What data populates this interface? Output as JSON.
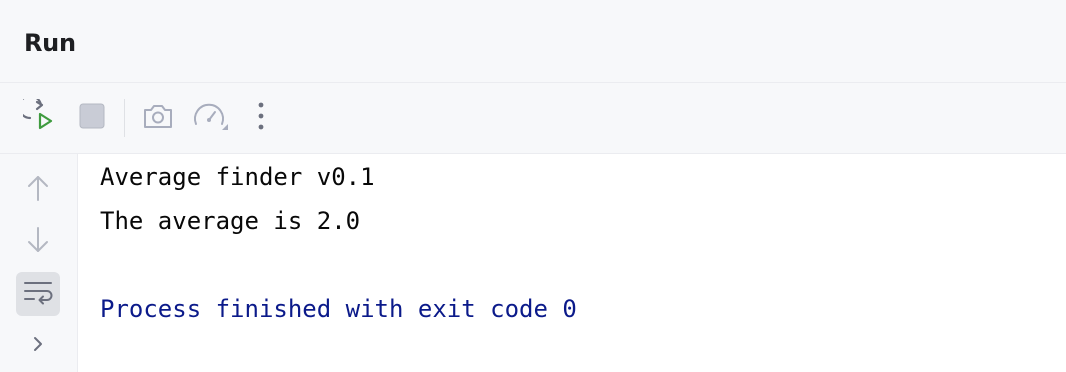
{
  "window": {
    "title": "Run"
  },
  "toolbar": {
    "buttons": [
      {
        "name": "rerun",
        "icon": "rerun-icon",
        "enabled": true
      },
      {
        "name": "stop",
        "icon": "stop-icon",
        "enabled": false
      },
      {
        "name": "screenshot",
        "icon": "camera-icon",
        "enabled": false
      },
      {
        "name": "profiler",
        "icon": "gauge-icon",
        "enabled": false
      },
      {
        "name": "more",
        "icon": "more-vertical-icon",
        "enabled": true
      }
    ]
  },
  "gutter": {
    "buttons": [
      {
        "name": "previous-occurrence",
        "icon": "arrow-up-icon"
      },
      {
        "name": "next-occurrence",
        "icon": "arrow-down-icon"
      },
      {
        "name": "soft-wrap",
        "icon": "soft-wrap-icon",
        "active": true
      },
      {
        "name": "expand",
        "icon": "chevron-right-icon"
      }
    ]
  },
  "console": {
    "lines": [
      {
        "text": "Average finder v0.1",
        "kind": "stdout"
      },
      {
        "text": "The average is 2.0",
        "kind": "stdout"
      },
      {
        "text": "",
        "kind": "stdout"
      },
      {
        "text": "Process finished with exit code 0",
        "kind": "system"
      }
    ]
  },
  "colors": {
    "stdout": "#080808",
    "system": "#0b1a8a",
    "run_green": "#3f9b3f",
    "panel_bg": "#f7f8fa",
    "border": "#ebecf0"
  }
}
